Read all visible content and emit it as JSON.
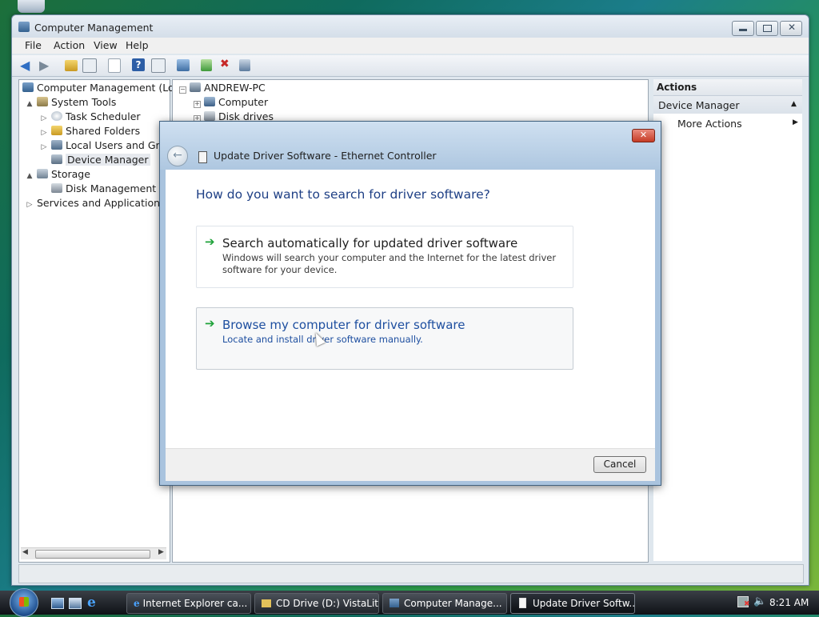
{
  "window": {
    "title": "Computer Management"
  },
  "menu": [
    "File",
    "Action",
    "View",
    "Help"
  ],
  "toolbar_icons": [
    "back-icon",
    "forward-icon",
    "up-folder-icon",
    "show-hide-tree-icon",
    "properties-icon",
    "help-icon",
    "show-hide-action-pane-icon",
    "scan-hardware-icon",
    "update-driver-icon",
    "disable-device-icon",
    "uninstall-device-icon"
  ],
  "tree": [
    {
      "label": "Computer Management (Local",
      "indent": 0,
      "expander": ""
    },
    {
      "label": "System Tools",
      "indent": 1,
      "expander": "▲"
    },
    {
      "label": "Task Scheduler",
      "indent": 2,
      "expander": "▷"
    },
    {
      "label": "Shared Folders",
      "indent": 2,
      "expander": "▷"
    },
    {
      "label": "Local Users and Group",
      "indent": 2,
      "expander": "▷"
    },
    {
      "label": "Device Manager",
      "indent": 2,
      "expander": ""
    },
    {
      "label": "Storage",
      "indent": 1,
      "expander": "▲"
    },
    {
      "label": "Disk Management",
      "indent": 2,
      "expander": ""
    },
    {
      "label": "Services and Applications",
      "indent": 1,
      "expander": "▷"
    }
  ],
  "devices": {
    "root": "ANDREW-PC",
    "items": [
      "Computer",
      "Disk drives"
    ]
  },
  "actions": {
    "header": "Actions",
    "section": "Device Manager",
    "more": "More Actions"
  },
  "dialog": {
    "title": "Update Driver Software - Ethernet Controller",
    "heading": "How do you want to search for driver software?",
    "option1_title": "Search automatically for updated driver software",
    "option1_desc": "Windows will search your computer and the Internet for the latest driver software for your device.",
    "option2_title": "Browse my computer for driver software",
    "option2_desc": "Locate and install driver software manually.",
    "cancel": "Cancel",
    "close": "✕"
  },
  "taskbar": {
    "items": [
      "Internet Explorer ca...",
      "CD Drive (D:) VistaLite",
      "Computer Manage...",
      "Update Driver Softw..."
    ],
    "clock": "8:21 AM"
  }
}
